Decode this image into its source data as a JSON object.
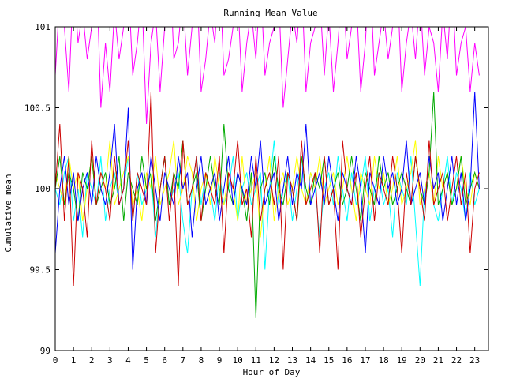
{
  "chart_data": {
    "type": "line",
    "title": "Running Mean Value",
    "xlabel": "Hour of Day",
    "ylabel": "Cumulative mean",
    "xlim": [
      0,
      23.75
    ],
    "ylim": [
      99,
      101
    ],
    "xticks": [
      0,
      1,
      2,
      3,
      4,
      5,
      6,
      7,
      8,
      9,
      10,
      11,
      12,
      13,
      14,
      15,
      16,
      17,
      18,
      19,
      20,
      21,
      22,
      23
    ],
    "yticks": [
      {
        "value": 99,
        "label": "99"
      },
      {
        "value": 99.5,
        "label": "99.5"
      },
      {
        "value": 100,
        "label": "100"
      },
      {
        "value": 100.5,
        "label": "100.5"
      },
      {
        "value": 101,
        "label": "101"
      }
    ],
    "grid": false,
    "legend": "none",
    "x_step": 0.25,
    "series": [
      {
        "color": "#ff00ff",
        "clip": true,
        "values": [
          100.7,
          101.2,
          101.0,
          100.6,
          101.3,
          100.9,
          101.1,
          100.8,
          101.0,
          101.4,
          100.5,
          100.9,
          100.6,
          101.1,
          100.8,
          101.0,
          101.3,
          100.7,
          100.9,
          101.2,
          100.4,
          100.9,
          101.1,
          100.6,
          101.0,
          101.5,
          100.8,
          100.9,
          101.2,
          100.7,
          101.0,
          101.3,
          100.6,
          100.8,
          101.1,
          100.9,
          101.4,
          100.7,
          100.8,
          101.0,
          101.2,
          100.6,
          100.9,
          101.1,
          100.8,
          101.3,
          100.7,
          100.9,
          101.0,
          101.2,
          100.5,
          100.8,
          101.1,
          100.9,
          101.3,
          100.6,
          100.9,
          101.0,
          101.2,
          100.7,
          101.1,
          100.6,
          100.9,
          101.3,
          100.8,
          101.0,
          101.2,
          100.6,
          100.9,
          101.4,
          100.7,
          100.9,
          101.1,
          100.8,
          101.0,
          101.3,
          100.6,
          100.9,
          101.1,
          100.8,
          101.2,
          100.7,
          101.0,
          100.9,
          100.6,
          101.1,
          100.8,
          101.3,
          100.7,
          100.9,
          101.0,
          100.6,
          100.9,
          100.7
        ]
      },
      {
        "color": "#00ffff",
        "values": [
          100.0,
          99.9,
          100.1,
          100.2,
          99.8,
          100.0,
          99.7,
          100.1,
          100.0,
          99.9,
          100.2,
          99.8,
          100.0,
          100.1,
          99.9,
          100.0,
          100.2,
          99.8,
          100.1,
          99.9,
          100.0,
          100.1,
          99.7,
          100.0,
          100.2,
          99.9,
          100.0,
          100.1,
          99.8,
          99.6,
          100.0,
          100.2,
          99.9,
          100.1,
          100.0,
          99.8,
          100.1,
          99.9,
          100.0,
          100.2,
          99.8,
          100.0,
          100.1,
          99.9,
          100.0,
          100.1,
          99.5,
          100.0,
          100.3,
          99.9,
          100.0,
          100.1,
          99.8,
          100.0,
          100.2,
          99.9,
          100.1,
          100.0,
          99.7,
          100.0,
          100.1,
          99.9,
          100.2,
          100.0,
          99.8,
          100.1,
          99.9,
          100.0,
          100.2,
          99.8,
          100.0,
          100.1,
          99.9,
          100.0,
          99.7,
          100.1,
          100.0,
          99.9,
          100.2,
          99.8,
          99.4,
          100.0,
          100.1,
          99.9,
          99.8,
          100.0,
          100.2,
          99.9,
          100.1,
          100.0,
          99.8,
          100.1,
          99.9,
          100.0
        ]
      },
      {
        "color": "#ffff00",
        "values": [
          100.1,
          100.0,
          99.9,
          100.2,
          100.0,
          100.1,
          99.8,
          100.0,
          100.2,
          99.9,
          100.1,
          100.0,
          100.3,
          99.9,
          100.0,
          100.1,
          100.2,
          99.9,
          100.0,
          99.8,
          100.1,
          100.0,
          100.2,
          99.9,
          100.0,
          100.1,
          100.3,
          99.9,
          100.0,
          100.2,
          100.1,
          99.8,
          100.0,
          100.1,
          99.9,
          100.2,
          100.0,
          99.9,
          100.1,
          100.0,
          99.8,
          100.2,
          99.9,
          100.0,
          100.1,
          99.7,
          100.0,
          100.2,
          99.8,
          100.0,
          100.1,
          99.9,
          100.0,
          100.2,
          100.0,
          99.9,
          100.1,
          100.0,
          100.2,
          99.9,
          100.0,
          100.1,
          99.9,
          100.0,
          100.2,
          100.0,
          99.8,
          100.1,
          100.0,
          99.9,
          100.2,
          100.0,
          100.1,
          99.9,
          100.0,
          100.2,
          99.9,
          100.0,
          100.1,
          100.3,
          99.9,
          100.0,
          100.1,
          99.9,
          100.2,
          100.0,
          100.1,
          99.9,
          100.0,
          100.2,
          100.0,
          99.9,
          100.1,
          100.0
        ]
      },
      {
        "color": "#00aa00",
        "values": [
          100.0,
          100.2,
          99.9,
          100.1,
          100.0,
          99.8,
          100.1,
          100.0,
          100.2,
          99.9,
          100.0,
          100.1,
          99.9,
          100.0,
          100.2,
          99.8,
          100.1,
          100.0,
          99.9,
          100.2,
          100.0,
          100.1,
          99.8,
          100.0,
          100.2,
          99.9,
          100.1,
          100.0,
          100.3,
          99.9,
          100.0,
          100.1,
          99.8,
          100.0,
          100.2,
          100.0,
          99.9,
          100.4,
          100.0,
          99.9,
          100.1,
          100.0,
          99.8,
          100.1,
          99.2,
          100.0,
          100.1,
          99.9,
          100.2,
          100.0,
          99.9,
          100.1,
          100.0,
          99.8,
          100.2,
          100.0,
          99.9,
          100.1,
          100.0,
          100.2,
          99.9,
          100.0,
          100.1,
          99.9,
          100.0,
          100.2,
          100.0,
          99.8,
          100.1,
          100.0,
          99.9,
          100.2,
          100.0,
          100.1,
          99.9,
          100.0,
          100.1,
          100.0,
          99.9,
          100.2,
          100.0,
          99.9,
          100.1,
          100.6,
          99.9,
          100.0,
          100.1,
          99.9,
          100.0,
          100.2,
          99.9,
          100.0,
          100.1,
          100.0
        ]
      },
      {
        "color": "#0000ff",
        "values": [
          99.6,
          100.0,
          100.2,
          99.9,
          100.1,
          99.8,
          100.0,
          100.1,
          99.9,
          100.2,
          100.0,
          99.9,
          100.1,
          100.4,
          99.9,
          100.0,
          100.5,
          99.5,
          100.0,
          100.1,
          99.9,
          100.2,
          100.0,
          99.8,
          100.1,
          100.0,
          99.9,
          100.2,
          100.0,
          100.1,
          99.7,
          100.0,
          100.2,
          99.9,
          100.0,
          100.1,
          99.8,
          100.0,
          100.2,
          99.9,
          100.1,
          100.0,
          99.9,
          100.2,
          100.0,
          100.3,
          99.9,
          100.0,
          100.1,
          99.8,
          100.0,
          100.2,
          99.9,
          100.1,
          100.0,
          100.4,
          99.9,
          100.0,
          100.1,
          99.9,
          100.2,
          100.0,
          99.8,
          100.1,
          100.0,
          99.9,
          100.2,
          100.0,
          99.6,
          100.1,
          100.0,
          99.9,
          100.2,
          100.0,
          100.1,
          99.9,
          100.0,
          100.3,
          99.9,
          100.0,
          100.1,
          99.9,
          100.2,
          100.0,
          100.1,
          99.8,
          100.0,
          100.2,
          99.9,
          100.1,
          99.8,
          100.0,
          100.6,
          100.0
        ]
      },
      {
        "color": "#cc0000",
        "values": [
          100.0,
          100.4,
          99.8,
          100.2,
          99.4,
          100.1,
          100.0,
          99.7,
          100.3,
          99.9,
          100.1,
          100.0,
          99.8,
          100.2,
          99.9,
          100.0,
          100.3,
          99.8,
          100.1,
          100.0,
          99.9,
          100.6,
          99.6,
          100.0,
          100.2,
          99.8,
          100.1,
          99.4,
          100.3,
          99.9,
          100.0,
          100.2,
          99.8,
          100.1,
          100.0,
          99.9,
          100.2,
          99.6,
          100.1,
          100.0,
          100.3,
          99.9,
          100.0,
          99.7,
          100.2,
          99.8,
          100.0,
          100.1,
          99.9,
          100.2,
          99.5,
          100.1,
          100.0,
          99.8,
          100.3,
          99.9,
          100.0,
          100.1,
          99.6,
          100.2,
          99.9,
          100.0,
          99.5,
          100.3,
          100.0,
          99.9,
          100.1,
          99.7,
          100.0,
          100.2,
          99.8,
          100.1,
          100.0,
          99.9,
          100.2,
          100.0,
          99.6,
          100.1,
          99.9,
          100.2,
          100.0,
          99.8,
          100.3,
          99.9,
          100.0,
          100.1,
          99.8,
          100.0,
          100.2,
          99.9,
          100.1,
          99.6,
          100.0,
          100.1
        ]
      }
    ]
  }
}
